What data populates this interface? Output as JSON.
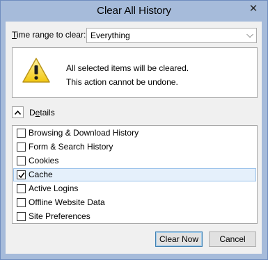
{
  "window": {
    "title": "Clear All History",
    "close_glyph": "✕"
  },
  "time_range": {
    "label_accel": "T",
    "label_rest": "ime range to clear:",
    "selected": "Everything"
  },
  "warning": {
    "line1": "All selected items will be cleared.",
    "line2": "This action cannot be undone.",
    "icon": "warning-icon"
  },
  "details": {
    "label_accel": "e",
    "label_pre": "D",
    "label_post": "tails",
    "expanded": true
  },
  "items": [
    {
      "label": "Browsing & Download History",
      "checked": false
    },
    {
      "label": "Form & Search History",
      "checked": false
    },
    {
      "label": "Cookies",
      "checked": false
    },
    {
      "label": "Cache",
      "checked": true
    },
    {
      "label": "Active Logins",
      "checked": false
    },
    {
      "label": "Offline Website Data",
      "checked": false
    },
    {
      "label": "Site Preferences",
      "checked": false
    }
  ],
  "buttons": {
    "clear_now": "Clear Now",
    "cancel": "Cancel"
  },
  "colors": {
    "frame": "#a6bbda",
    "selection": "#e5f0fb",
    "selection_border": "#99c1ea"
  }
}
